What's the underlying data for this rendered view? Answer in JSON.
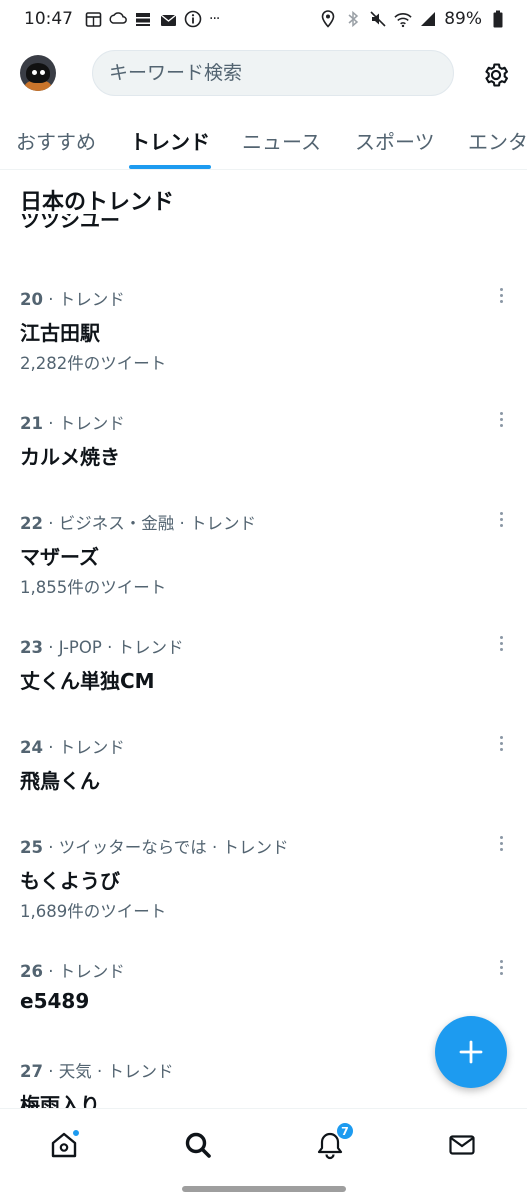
{
  "status_bar": {
    "time": "10:47",
    "battery": "89%",
    "more_indicator": "···"
  },
  "header": {
    "search_placeholder": "キーワード検索"
  },
  "tabs": [
    {
      "label": "おすすめ"
    },
    {
      "label": "トレンド"
    },
    {
      "label": "ニュース"
    },
    {
      "label": "スポーツ"
    },
    {
      "label": "エンタ"
    }
  ],
  "section": {
    "title": "日本のトレンド",
    "cutoff_text": "ツツシユー"
  },
  "trends": [
    {
      "rank": "20",
      "meta": " · トレンド",
      "name": "江古田駅",
      "count": "2,282件のツイート"
    },
    {
      "rank": "21",
      "meta": " · トレンド",
      "name": "カルメ焼き",
      "count": ""
    },
    {
      "rank": "22",
      "meta": " · ビジネス・金融 · トレンド",
      "name": "マザーズ",
      "count": "1,855件のツイート"
    },
    {
      "rank": "23",
      "meta": " · J-POP · トレンド",
      "name": "丈くん単独CM",
      "count": ""
    },
    {
      "rank": "24",
      "meta": " · トレンド",
      "name": "飛鳥くん",
      "count": ""
    },
    {
      "rank": "25",
      "meta": " · ツイッターならでは · トレンド",
      "name": "もくようび",
      "count": "1,689件のツイート"
    },
    {
      "rank": "26",
      "meta": " · トレンド",
      "name": "e5489",
      "count": ""
    },
    {
      "rank": "27",
      "meta": " · 天気 · トレンド",
      "name": "梅雨入り",
      "count": ""
    }
  ],
  "bottom_nav": {
    "notifications_badge": "7"
  },
  "colors": {
    "accent": "#1d9bf0",
    "text_primary": "#0f1419",
    "text_secondary": "#536471"
  }
}
